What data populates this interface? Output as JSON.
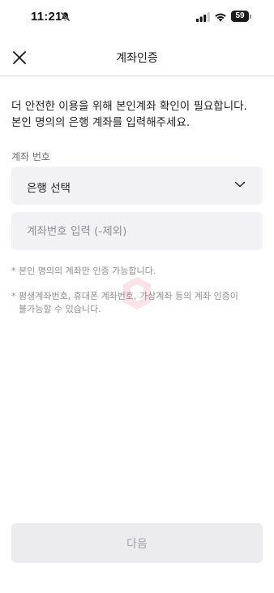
{
  "status_bar": {
    "time": "11:21",
    "battery_level": "59",
    "icons": [
      "bell-off-icon",
      "cellular-signal-icon",
      "wifi-icon",
      "battery-icon"
    ]
  },
  "header": {
    "title": "계좌인증",
    "close_icon": "close-icon"
  },
  "intro": {
    "line1": "더 안전한 이용을 위해 본인계좌 확인이 필요합니다.",
    "line2": "본인 명의의 은행 계좌를 입력해주세요."
  },
  "form": {
    "account_label": "계좌 번호",
    "bank_select": {
      "value": "은행 선택",
      "icon": "chevron-down-icon"
    },
    "account_input": {
      "placeholder": "계좌번호 입력 (-제외)",
      "value": ""
    }
  },
  "notes": {
    "note1": "* 본인 명의의 계좌만 인증 가능합니다.",
    "note2_line1": "* 평생계좌번호, 휴대폰 계좌번호, 가상계좌 등의 계좌 인증이",
    "note2_line2": "불가능할 수 있습니다."
  },
  "footer": {
    "next_label": "다음"
  },
  "colors": {
    "accent_watermark": "#e0334a",
    "field_bg": "#f2f2f4",
    "button_disabled_bg": "#ececef",
    "button_disabled_text": "#a5a5aa"
  }
}
